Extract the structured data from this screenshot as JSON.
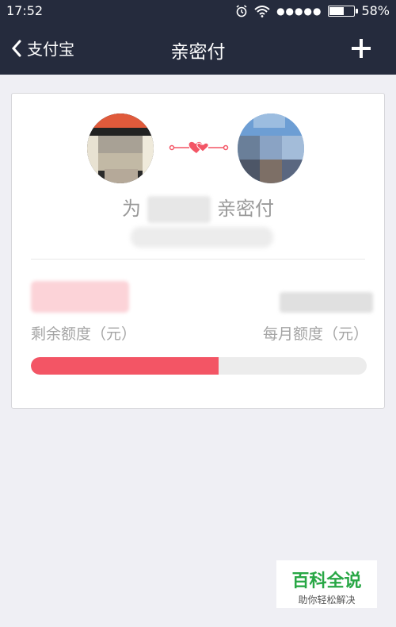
{
  "status_bar": {
    "time": "17:52",
    "signal_dots": "●●●●●",
    "battery_percent_text": "58%",
    "battery_level": 0.58
  },
  "navbar": {
    "back_label": "支付宝",
    "title": "亲密付",
    "add_icon": "plus-icon"
  },
  "card": {
    "subtitle_prefix": "为",
    "subtitle_suffix": "亲密付",
    "remaining_label": "剩余额度（元）",
    "monthly_label": "每月额度（元）",
    "usage_fraction": 0.56
  },
  "watermark": {
    "title": "百科全说",
    "subtitle": "助你轻松解决"
  },
  "colors": {
    "header_bg": "#252b3d",
    "accent": "#f35565",
    "page_bg": "#efeff4"
  }
}
